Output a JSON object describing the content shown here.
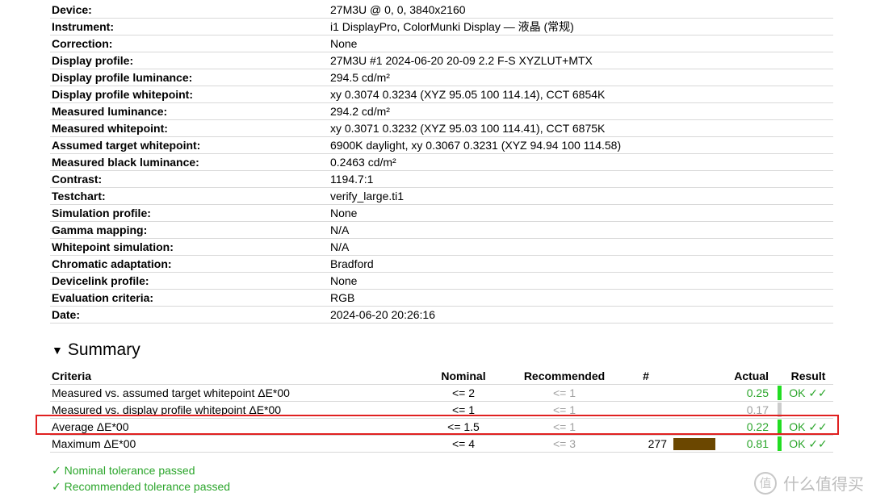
{
  "info": [
    {
      "key": "Device:",
      "value": "27M3U @ 0, 0, 3840x2160"
    },
    {
      "key": "Instrument:",
      "value": "i1 DisplayPro, ColorMunki Display — 液晶 (常规)"
    },
    {
      "key": "Correction:",
      "value": "None"
    },
    {
      "key": "Display profile:",
      "value": "27M3U #1 2024-06-20 20-09 2.2 F-S XYZLUT+MTX"
    },
    {
      "key": "Display profile luminance:",
      "value": "294.5 cd/m²"
    },
    {
      "key": "Display profile whitepoint:",
      "value": "xy 0.3074 0.3234 (XYZ 95.05 100 114.14), CCT 6854K"
    },
    {
      "key": "Measured luminance:",
      "value": "294.2 cd/m²"
    },
    {
      "key": "Measured whitepoint:",
      "value": "xy 0.3071 0.3232 (XYZ 95.03 100 114.41), CCT 6875K"
    },
    {
      "key": "Assumed target whitepoint:",
      "value": "6900K daylight, xy 0.3067 0.3231 (XYZ 94.94 100 114.58)"
    },
    {
      "key": "Measured black luminance:",
      "value": "0.2463 cd/m²"
    },
    {
      "key": "Contrast:",
      "value": "1194.7:1"
    },
    {
      "key": "Testchart:",
      "value": "verify_large.ti1"
    },
    {
      "key": "Simulation profile:",
      "value": "None"
    },
    {
      "key": "Gamma mapping:",
      "value": "N/A"
    },
    {
      "key": "Whitepoint simulation:",
      "value": "N/A"
    },
    {
      "key": "Chromatic adaptation:",
      "value": "Bradford"
    },
    {
      "key": "Devicelink profile:",
      "value": "None"
    },
    {
      "key": "Evaluation criteria:",
      "value": "RGB"
    },
    {
      "key": "Date:",
      "value": "2024-06-20 20:26:16"
    }
  ],
  "summary": {
    "title": "Summary",
    "toggle_icon": "triangle-down-icon",
    "headers": {
      "criteria": "Criteria",
      "nominal": "Nominal",
      "recommended": "Recommended",
      "count": "#",
      "actual": "Actual",
      "result": "Result"
    },
    "rows": [
      {
        "criteria": "Measured vs. assumed target whitepoint ΔE*00",
        "nominal": "<= 2",
        "recommended": "<= 1",
        "count": "",
        "swatch": "",
        "actual": "0.25",
        "actual_color": "#2aa52a",
        "bar": "#22dd22",
        "result": "OK ✓✓"
      },
      {
        "criteria": "Measured vs. display profile whitepoint ΔE*00",
        "nominal": "<= 1",
        "recommended": "<= 1",
        "count": "",
        "swatch": "",
        "actual": "0.17",
        "actual_color": "#a0a0a0",
        "bar": "#cccccc",
        "result": ""
      },
      {
        "criteria": "Average ΔE*00",
        "nominal": "<= 1.5",
        "recommended": "<= 1",
        "count": "",
        "swatch": "",
        "actual": "0.22",
        "actual_color": "#2aa52a",
        "bar": "#22dd22",
        "result": "OK ✓✓"
      },
      {
        "criteria": "Maximum ΔE*00",
        "nominal": "<= 4",
        "recommended": "<= 3",
        "count": "277",
        "swatch": "#6b4700",
        "actual": "0.81",
        "actual_color": "#2aa52a",
        "bar": "#22dd22",
        "result": "OK ✓✓"
      }
    ],
    "highlight_color": "#e02020"
  },
  "status": {
    "nominal_passed": "✓ Nominal tolerance passed",
    "recommended_passed": "✓ Recommended tolerance passed"
  },
  "watermark": {
    "logo_glyph": "值",
    "text": "什么值得买"
  }
}
